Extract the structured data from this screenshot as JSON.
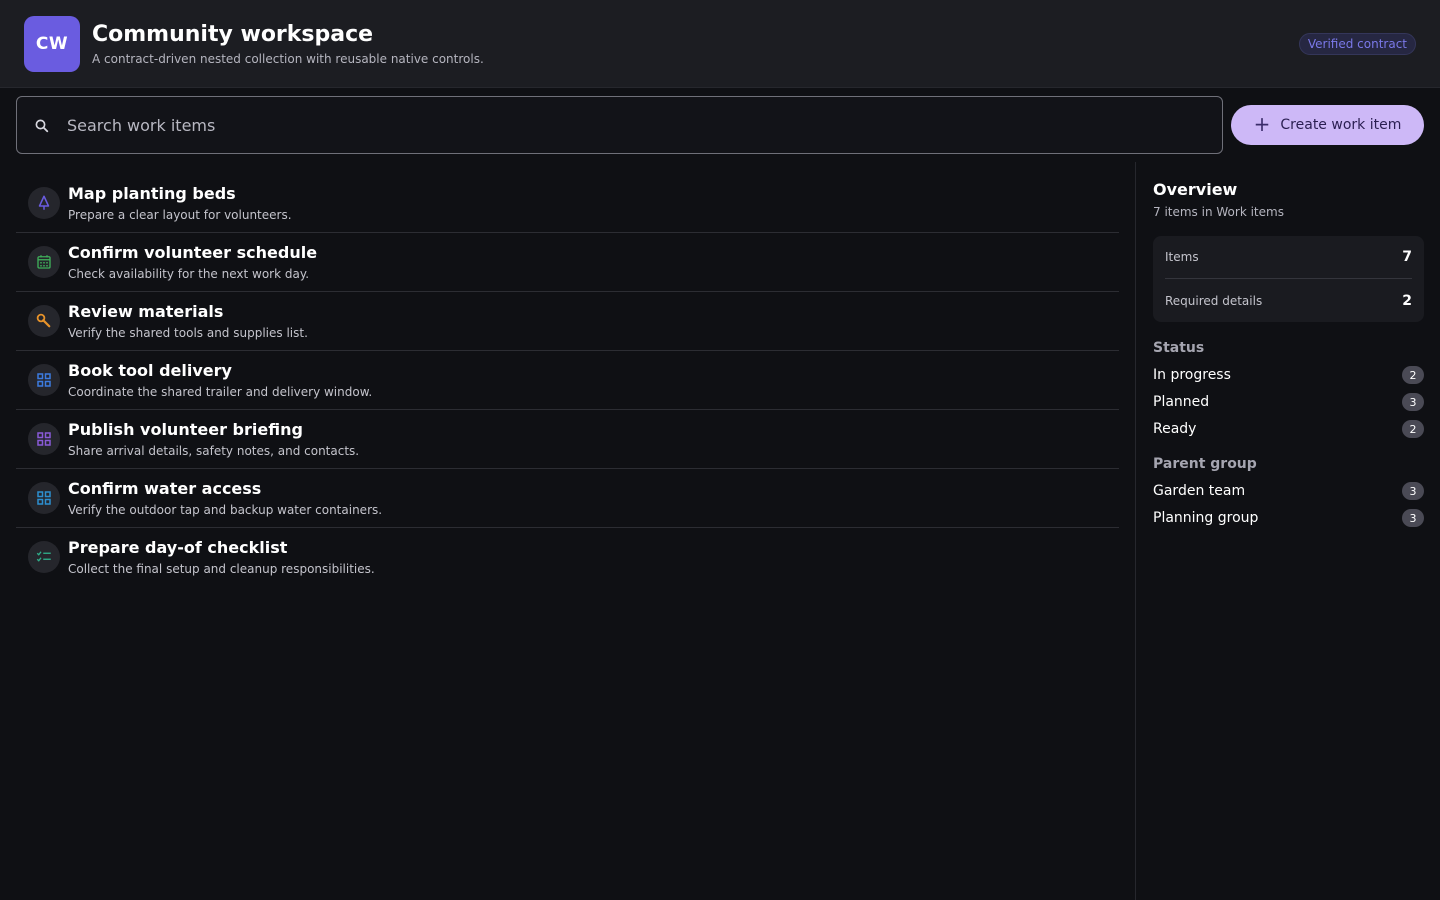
{
  "header": {
    "logo_text": "CW",
    "title": "Community workspace",
    "subtitle": "A contract-driven nested collection with reusable native controls.",
    "badge": "Verified contract"
  },
  "toolbar": {
    "search_placeholder": "Search work items",
    "search_value": "",
    "create_label": "Create work item"
  },
  "items": [
    {
      "title": "Map planting beds",
      "description": "Prepare a clear layout for volunteers.",
      "icon": "tree-icon",
      "color": "#6a5ce0"
    },
    {
      "title": "Confirm volunteer schedule",
      "description": "Check availability for the next work day.",
      "icon": "calendar-icon",
      "color": "#3fae5a"
    },
    {
      "title": "Review materials",
      "description": "Verify the shared tools and supplies list.",
      "icon": "wrench-icon",
      "color": "#e8932a"
    },
    {
      "title": "Book tool delivery",
      "description": "Coordinate the shared trailer and delivery window.",
      "icon": "grid-icon",
      "color": "#3c7be0"
    },
    {
      "title": "Publish volunteer briefing",
      "description": "Share arrival details, safety notes, and contacts.",
      "icon": "grid-icon",
      "color": "#8a5ad8"
    },
    {
      "title": "Confirm water access",
      "description": "Verify the outdoor tap and backup water containers.",
      "icon": "grid-icon",
      "color": "#2d8fd0"
    },
    {
      "title": "Prepare day-of checklist",
      "description": "Collect the final setup and cleanup responsibilities.",
      "icon": "checklist-icon",
      "color": "#2fae8a"
    }
  ],
  "overview": {
    "title": "Overview",
    "subtitle": "7 items in Work items",
    "stats": [
      {
        "label": "Items",
        "value": "7"
      },
      {
        "label": "Required details",
        "value": "2"
      }
    ],
    "status_title": "Status",
    "status": [
      {
        "label": "In progress",
        "count": "2"
      },
      {
        "label": "Planned",
        "count": "3"
      },
      {
        "label": "Ready",
        "count": "2"
      }
    ],
    "parent_title": "Parent group",
    "parents": [
      {
        "label": "Garden team",
        "count": "3"
      },
      {
        "label": "Planning group",
        "count": "3"
      }
    ]
  }
}
